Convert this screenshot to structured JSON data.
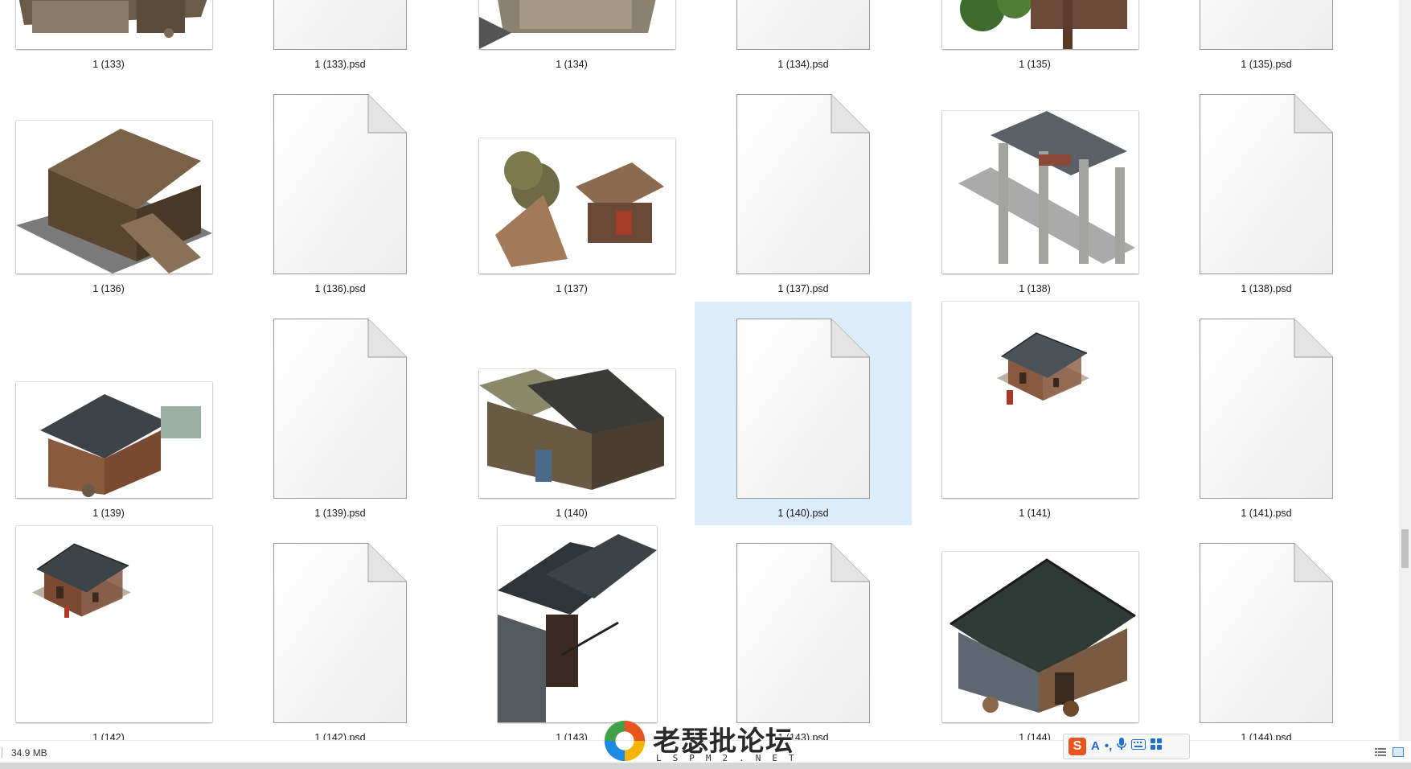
{
  "files": [
    {
      "name": "1 (133)",
      "kind": "image",
      "art": "shed"
    },
    {
      "name": "1 (133).psd",
      "kind": "psd"
    },
    {
      "name": "1 (134)",
      "kind": "image",
      "art": "stonehouse"
    },
    {
      "name": "1 (134).psd",
      "kind": "psd"
    },
    {
      "name": "1 (135)",
      "kind": "image",
      "art": "garden"
    },
    {
      "name": "1 (135).psd",
      "kind": "psd"
    },
    {
      "name": "1 (136)",
      "kind": "image",
      "art": "fortress"
    },
    {
      "name": "1 (136).psd",
      "kind": "psd"
    },
    {
      "name": "1 (137)",
      "kind": "image",
      "art": "market-stall"
    },
    {
      "name": "1 (137).psd",
      "kind": "psd"
    },
    {
      "name": "1 (138)",
      "kind": "image",
      "art": "archway"
    },
    {
      "name": "1 (138).psd",
      "kind": "psd"
    },
    {
      "name": "1 (139)",
      "kind": "image",
      "art": "wooden-house"
    },
    {
      "name": "1 (139).psd",
      "kind": "psd"
    },
    {
      "name": "1 (140)",
      "kind": "image",
      "art": "thatched-house"
    },
    {
      "name": "1 (140).psd",
      "kind": "psd",
      "selected": true
    },
    {
      "name": "1 (141)",
      "kind": "image",
      "art": "small-temple"
    },
    {
      "name": "1 (141).psd",
      "kind": "psd"
    },
    {
      "name": "1 (142)",
      "kind": "image",
      "art": "small-hall"
    },
    {
      "name": "1 (142).psd",
      "kind": "psd"
    },
    {
      "name": "1 (143)",
      "kind": "image",
      "art": "corner-roof"
    },
    {
      "name": "1 (143).psd",
      "kind": "psd"
    },
    {
      "name": "1 (144)",
      "kind": "image",
      "art": "big-hall"
    },
    {
      "name": "1 (144).psd",
      "kind": "psd"
    }
  ],
  "status": {
    "selected_size": "34.9 MB"
  },
  "ime_toolbar": {
    "logo": "S",
    "items": [
      "A",
      "•,",
      "mic-icon",
      "keyboard-icon",
      "apps-icon"
    ]
  },
  "watermark": {
    "title": "老瑟批论坛",
    "subtitle": "LSPM2.NET"
  },
  "colors": {
    "selection": "#dcecfb",
    "scrollbar_thumb": "#c1c1c1",
    "watermark_logo": [
      "#e8541e",
      "#f4b400",
      "#1e88e5",
      "#43a047"
    ]
  }
}
